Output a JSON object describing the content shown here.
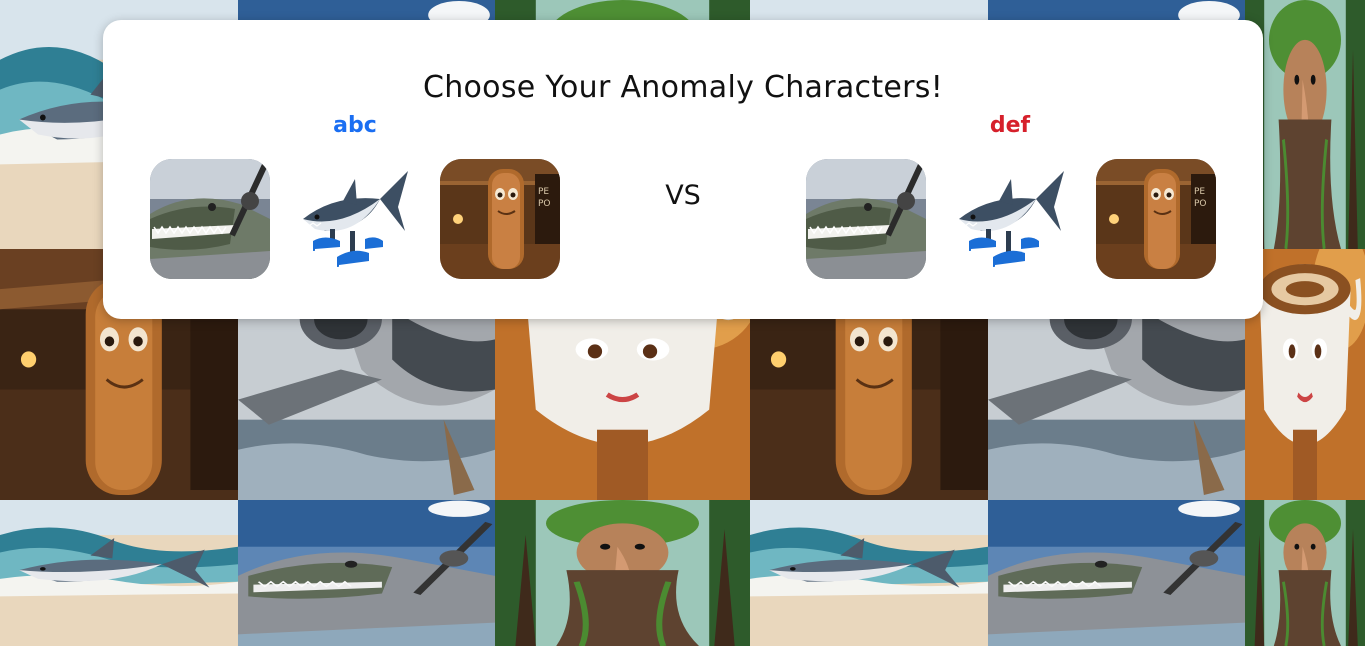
{
  "title": "Choose Your Anomaly Characters!",
  "vs_label": "VS",
  "player1": {
    "name": "abc",
    "color": "#1a6ef2",
    "characters": [
      "crocodile-airplane",
      "shark-sneakers",
      "wooden-log-man"
    ]
  },
  "player2": {
    "name": "def",
    "color": "#d6202b",
    "characters": [
      "crocodile-airplane",
      "shark-sneakers",
      "wooden-log-man"
    ]
  },
  "background_tiles": [
    "shark-beach",
    "crocodile-airplane",
    "monkey-tree",
    "shark-beach",
    "crocodile-airplane",
    "monkey-tree",
    "wooden-log-man",
    "crocodile-airplane-close",
    "coffee-cup-lady",
    "wooden-log-man",
    "crocodile-airplane-close",
    "coffee-cup-lady",
    "shark-beach",
    "crocodile-airplane",
    "monkey-tree",
    "shark-beach",
    "crocodile-airplane",
    "monkey-tree"
  ]
}
